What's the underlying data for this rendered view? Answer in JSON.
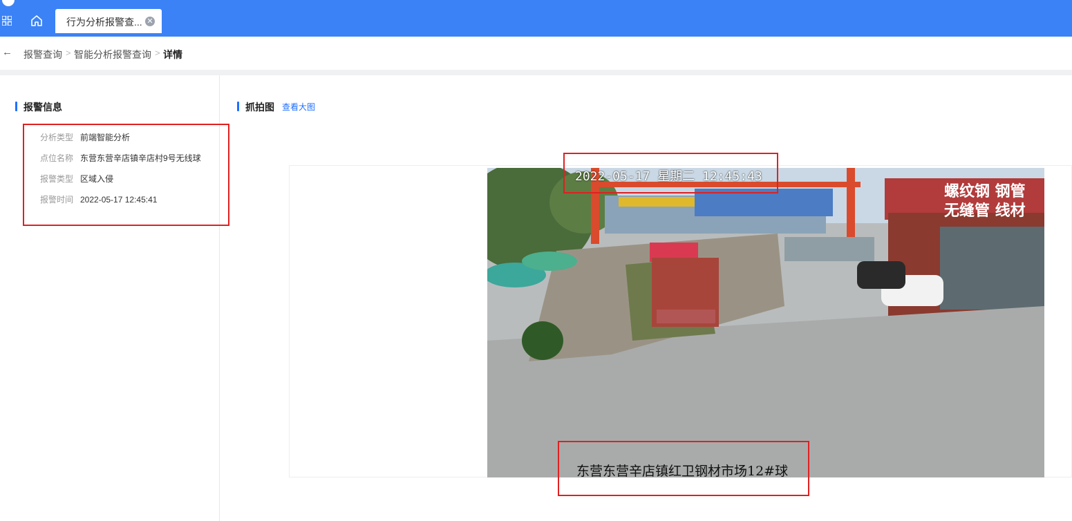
{
  "topbar": {
    "tab_label": "行为分析报警查...",
    "tab_close_symbol": "✕",
    "icons": [
      "apps-grid-icon",
      "home-icon",
      "close-circle-icon"
    ],
    "brand_color": "#3b82f6"
  },
  "breadcrumb": {
    "back_symbol": "←",
    "items": [
      "报警查询",
      "智能分析报警查询",
      "详情"
    ],
    "separator": ">"
  },
  "alarm_info": {
    "heading": "报警信息",
    "rows": [
      {
        "label": "分析类型",
        "value": "前端智能分析"
      },
      {
        "label": "点位名称",
        "value": "东营东营辛店镇辛店村9号无线球"
      },
      {
        "label": "报警类型",
        "value": "区域入侵"
      },
      {
        "label": "报警时间",
        "value": "2022-05-17 12:45:41"
      }
    ]
  },
  "snapshot": {
    "heading": "抓拍图",
    "view_large_link": "查看大图",
    "osd_timestamp": "2022-05-17 星期二 12:45:43",
    "osd_location": "东营东营辛店镇红卫钢材市场12#球",
    "sign_line1": "螺纹钢 钢管",
    "sign_line2": "无缝管 线材"
  },
  "colors": {
    "accent": "#1f6fff",
    "highlight_box": "#e02020"
  }
}
